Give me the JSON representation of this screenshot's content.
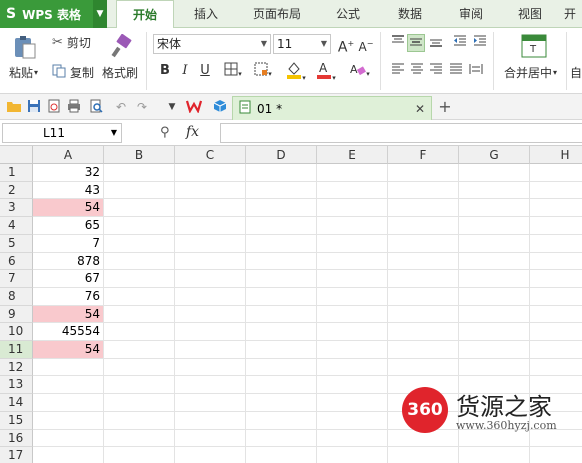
{
  "app": {
    "menu_button": "WPS 表格",
    "logo_glyph": "S"
  },
  "tabs": [
    {
      "label": "开始",
      "active": true
    },
    {
      "label": "插入"
    },
    {
      "label": "页面布局"
    },
    {
      "label": "公式"
    },
    {
      "label": "数据"
    },
    {
      "label": "审阅"
    },
    {
      "label": "视图"
    },
    {
      "label": "开"
    }
  ],
  "ribbon": {
    "paste_label": "粘贴",
    "cut_label": "剪切",
    "copy_label": "复制",
    "format_painter_label": "格式刷",
    "font_name": "宋体",
    "font_size": "11",
    "bold": "B",
    "italic": "I",
    "underline": "U",
    "merge_label": "合并居中",
    "auto_label": "自",
    "font_color": "#e53935",
    "fill_color": "#f5c300"
  },
  "document": {
    "tab_name": "01 *"
  },
  "formula_bar": {
    "cell_ref": "L11",
    "fx": "fx"
  },
  "sheet": {
    "columns": [
      "A",
      "B",
      "C",
      "D",
      "E",
      "F",
      "G",
      "H"
    ],
    "rows": [
      "1",
      "2",
      "3",
      "4",
      "5",
      "6",
      "7",
      "8",
      "9",
      "10",
      "11",
      "12",
      "13",
      "14",
      "15",
      "16",
      "17"
    ],
    "selected_row": "11",
    "column_a_values": [
      "32",
      "43",
      "54",
      "65",
      "7",
      "878",
      "67",
      "76",
      "54",
      "45554",
      "54"
    ],
    "highlighted_rows": [
      "3",
      "9",
      "11"
    ],
    "highlight_color": "#f9c9cd"
  },
  "watermark": {
    "logo_text": "360",
    "brand": "货源之家",
    "url": "www.360hyzj.com"
  }
}
